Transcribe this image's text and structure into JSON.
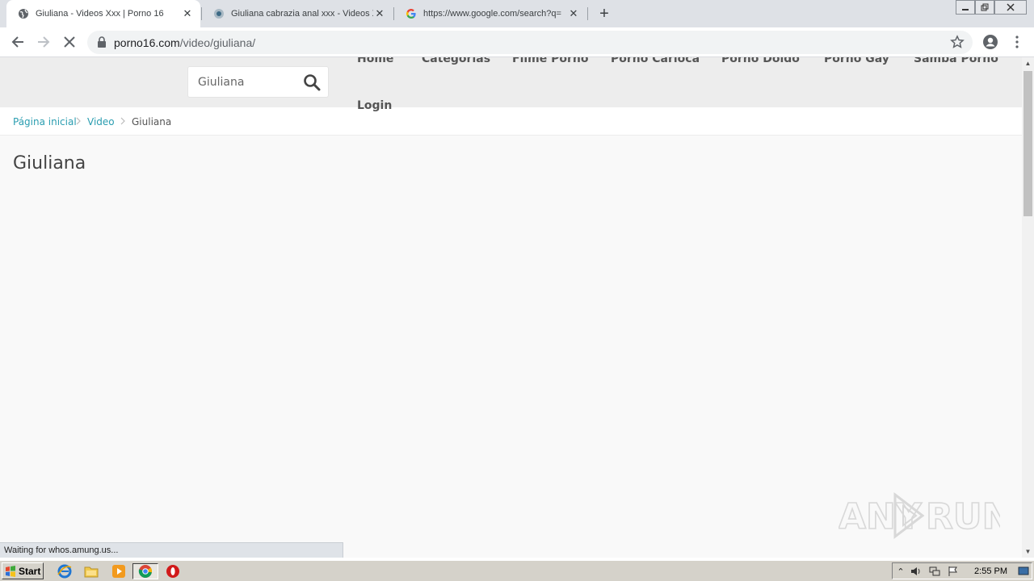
{
  "browser": {
    "tabs": [
      {
        "title": "Giuliana - Videos Xxx | Porno 16",
        "active": true,
        "favicon": "globe-icon"
      },
      {
        "title": "Giuliana cabrazia anal xxx - Videos X",
        "active": false,
        "favicon": "site-favicon-icon"
      },
      {
        "title": "https://www.google.com/search?q=",
        "active": false,
        "favicon": "google-icon"
      }
    ],
    "address": {
      "host": "porno16.com",
      "path": "/video/giuliana/"
    }
  },
  "site": {
    "search": {
      "value": "Giuliana"
    },
    "nav": [
      "Home",
      "Categorias",
      "Filme Porno",
      "Porno Carioca",
      "Porno Doido",
      "Porno Gay",
      "Samba Porno",
      "Login"
    ],
    "breadcrumb": {
      "home": "Página inicial",
      "section": "Video",
      "current": "Giuliana"
    },
    "page_title": "Giuliana"
  },
  "status_text": "Waiting for whos.amung.us...",
  "watermark": "ANY RUN",
  "taskbar": {
    "start_label": "Start",
    "clock": "2:55 PM"
  }
}
